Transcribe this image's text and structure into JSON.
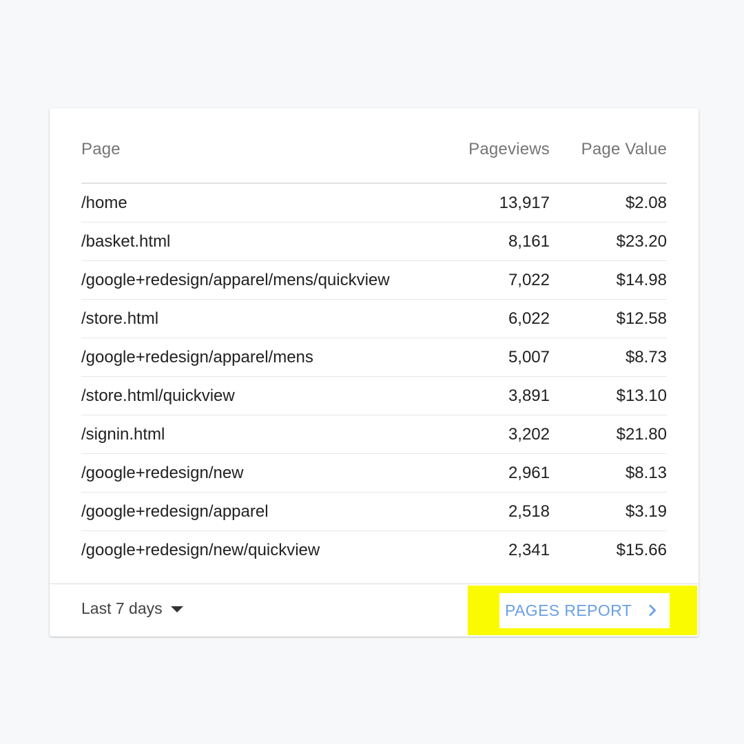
{
  "table": {
    "headers": {
      "page": "Page",
      "pageviews": "Pageviews",
      "page_value": "Page Value"
    },
    "rows": [
      {
        "page": "/home",
        "pageviews": "13,917",
        "page_value": "$2.08"
      },
      {
        "page": "/basket.html",
        "pageviews": "8,161",
        "page_value": "$23.20"
      },
      {
        "page": "/google+redesign/apparel/mens/quickview",
        "pageviews": "7,022",
        "page_value": "$14.98"
      },
      {
        "page": "/store.html",
        "pageviews": "6,022",
        "page_value": "$12.58"
      },
      {
        "page": "/google+redesign/apparel/mens",
        "pageviews": "5,007",
        "page_value": "$8.73"
      },
      {
        "page": "/store.html/quickview",
        "pageviews": "3,891",
        "page_value": "$13.10"
      },
      {
        "page": "/signin.html",
        "pageviews": "3,202",
        "page_value": "$21.80"
      },
      {
        "page": "/google+redesign/new",
        "pageviews": "2,961",
        "page_value": "$8.13"
      },
      {
        "page": "/google+redesign/apparel",
        "pageviews": "2,518",
        "page_value": "$3.19"
      },
      {
        "page": "/google+redesign/new/quickview",
        "pageviews": "2,341",
        "page_value": "$15.66"
      }
    ]
  },
  "footer": {
    "date_range": "Last 7 days",
    "date_range_icon": "caret-down-icon",
    "report_button": "PAGES REPORT",
    "report_button_icon": "chevron-right-icon"
  },
  "colors": {
    "background": "#f7f8fa",
    "link": "#6a9fe6",
    "highlight": "#fbfb00",
    "header_text": "#757575"
  }
}
